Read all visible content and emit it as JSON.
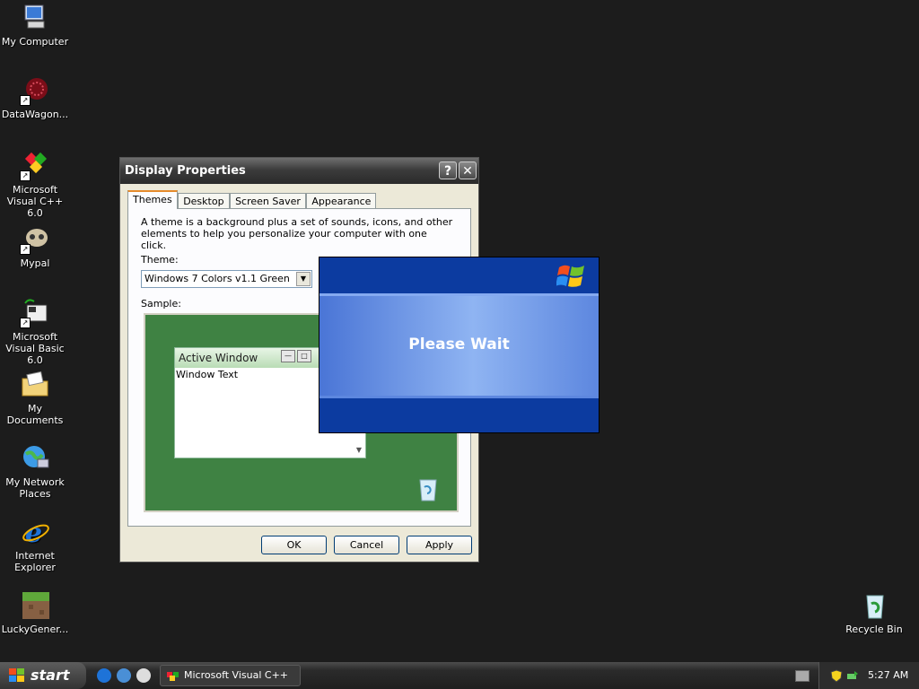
{
  "desktop": {
    "icons": [
      {
        "label": "My Computer"
      },
      {
        "label": "DataWagon..."
      },
      {
        "label": "Microsoft Visual C++ 6.0"
      },
      {
        "label": "Mypal"
      },
      {
        "label": "Microsoft Visual Basic 6.0"
      },
      {
        "label": "My Documents"
      },
      {
        "label": "My Network Places"
      },
      {
        "label": "Internet Explorer"
      },
      {
        "label": "LuckyGener..."
      },
      {
        "label": "Recycle Bin"
      }
    ]
  },
  "display_properties": {
    "title": "Display Properties",
    "help_label": "?",
    "close_label": "✕",
    "tabs": [
      "Themes",
      "Desktop",
      "Screen Saver",
      "Appearance"
    ],
    "description": "A theme is a background plus a set of sounds, icons, and other elements to help you personalize your computer with one click.",
    "theme_label": "Theme:",
    "theme_value": "Windows 7 Colors v1.1 Green",
    "sample_label": "Sample:",
    "sample": {
      "window_title": "Active Window",
      "window_text": "Window Text",
      "background_color": "#3f8243"
    },
    "buttons": {
      "ok": "OK",
      "cancel": "Cancel",
      "apply": "Apply"
    }
  },
  "please_wait": {
    "text": "Please Wait"
  },
  "taskbar": {
    "start_label": "start",
    "task_label": "Microsoft Visual C++",
    "clock": "5:27 AM"
  }
}
